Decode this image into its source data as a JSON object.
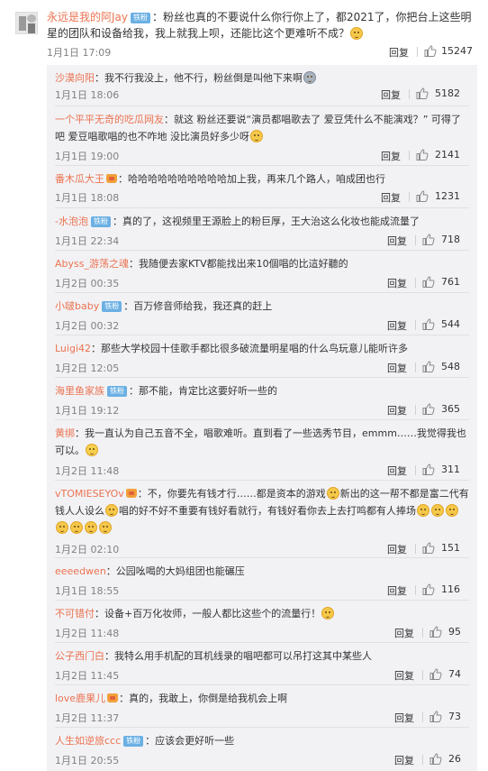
{
  "labels": {
    "reply": "回复",
    "verified": "铁粉"
  },
  "top_comment": {
    "user": "永远是我的阿Jay",
    "badge": "铁粉",
    "text": "：粉丝也真的不要说什么你行你上了，都2021了，你把台上这些明星的团队和设备给我，我上就我上呗，还能比这个更难听不成？",
    "date": "1月1日 17:09",
    "likes": "15247"
  },
  "replies": [
    {
      "user": "沙漠向阳",
      "text": "：我不行我没上，他不行，粉丝倒是叫他下来啊",
      "date": "1月1日 18:06",
      "likes": "5182"
    },
    {
      "user": "一个平平无奇的吃瓜网友",
      "text": "：就这 粉丝还要说“演员都唱歌去了 爱豆凭什么不能演戏？” 可得了吧 爱豆唱歌唱的也不咋地 没比演员好多少呀",
      "date": "1月1日 19:00",
      "likes": "2141"
    },
    {
      "user": "番木瓜大王",
      "text": "：哈哈哈哈哈哈哈哈哈哈加上我，再来几个路人，咱成团也行",
      "date": "1月1日 18:08",
      "likes": "1231"
    },
    {
      "user": "-水泡泡",
      "badge": "铁粉",
      "text": "：真的了，这视频里王源脸上的粉巨厚，王大治这么化妆也能成流量了",
      "date": "1月1日 22:34",
      "likes": "718"
    },
    {
      "user": "Abyss_游荡之魂",
      "text": "：我随便去家KTV都能找出来10個唱的比這好聽的",
      "date": "1月2日 00:35",
      "likes": "761"
    },
    {
      "user": "小啵baby",
      "badge": "铁粉",
      "text": "：百万修音师给我，我还真的赶上",
      "date": "1月2日 00:32",
      "likes": "544"
    },
    {
      "user": "Luigi42",
      "text": "：那些大学校园十佳歌手都比很多破流量明星唱的什么鸟玩意儿能听许多",
      "date": "1月2日 12:05",
      "likes": "548"
    },
    {
      "user": "海里鱼家族",
      "badge": "铁粉",
      "text": "：那不能，肯定比这要好听一些的",
      "date": "1月1日 19:12",
      "likes": "365"
    },
    {
      "user": "黄绑",
      "text": "：我一直认为自己五音不全，唱歌难听。直到看了一些选秀节目，emmm……我觉得我也可以。",
      "date": "1月2日 11:48",
      "likes": "311"
    },
    {
      "user": "vTOMIESEYOv",
      "text": "：不，你要先有钱才行……都是资本的游戏",
      "text2": "新出的这一帮不都是富二代有钱人人设么",
      "text3": "唱的好不好不重要有钱好看就行，有钱好看你去上去打鸣都有人捧场",
      "date": "1月2日 02:10",
      "likes": "151"
    },
    {
      "user": "eeeedwen",
      "text": "：公园吆喝的大妈组团也能碾压",
      "date": "1月1日 18:55",
      "likes": "116"
    },
    {
      "user": "不可错付",
      "text": "：设备+百万化妆师，一般人都比这些个的流量行！",
      "date": "1月2日 11:48",
      "likes": "95"
    },
    {
      "user": "公子西门白",
      "text": "：我特么用手机配的耳机线录的唱吧都可以吊打这其中某些人",
      "date": "1月2日 11:45",
      "likes": "74"
    },
    {
      "user": "love鹿果儿",
      "text": "：真的，我敢上，你倒是给我机会上啊",
      "date": "1月2日 11:37",
      "likes": "73"
    },
    {
      "user": "人生如逆旅ccc",
      "badge": "铁粉",
      "text": "：应该会更好听一些",
      "date": "1月1日 20:55",
      "likes": "26"
    }
  ]
}
